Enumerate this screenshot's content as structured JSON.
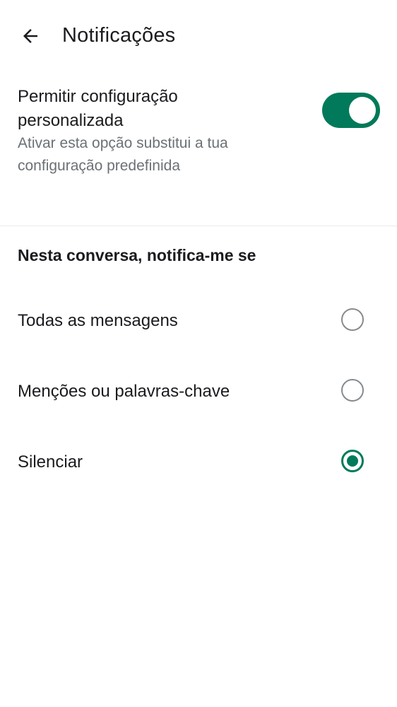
{
  "header": {
    "back_icon": "arrow-left-icon",
    "title": "Notificações"
  },
  "custom_setting": {
    "title": "Permitir configuração personalizada",
    "subtitle": "Ativar esta opção substitui a tua configuração predefinida",
    "toggle_on": true,
    "accent_color": "#007a5a"
  },
  "section": {
    "heading": "Nesta conversa, notifica-me se"
  },
  "options": [
    {
      "label": "Todas as mensagens",
      "selected": false
    },
    {
      "label": "Menções ou palavras-chave",
      "selected": false
    },
    {
      "label": "Silenciar",
      "selected": true
    }
  ]
}
